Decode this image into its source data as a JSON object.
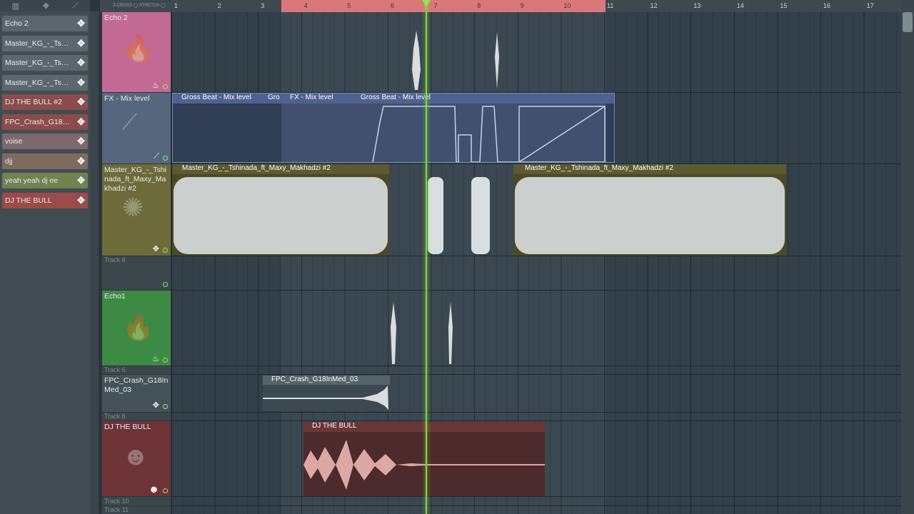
{
  "browser": {
    "clips": [
      {
        "label": "Echo 2",
        "color": "#5c676d"
      },
      {
        "label": "Master_KG_-_Tshina...",
        "color": "#5c676d"
      },
      {
        "label": "Master_KG_-_Tshina...",
        "color": "#5c676d"
      },
      {
        "label": "Master_KG_-_Tshina...",
        "color": "#5c676d"
      },
      {
        "label": "DJ THE BULL #2",
        "color": "#8a4d4c"
      },
      {
        "label": "FPC_Crash_G18InMe...",
        "color": "#8a4d4c"
      },
      {
        "label": "voise",
        "color": "#7d686d"
      },
      {
        "label": "djj",
        "color": "#7f6a62"
      },
      {
        "label": "yeah yeah dj ee",
        "color": "#6f8250"
      },
      {
        "label": "DJ THE BULL",
        "color": "#9c4a4a"
      }
    ],
    "move_icon": "✥"
  },
  "ruler": {
    "zcross": "Z-CROSS",
    "stretch": "STRETCH",
    "bars": [
      "1",
      "2",
      "3",
      "4",
      "5",
      "6",
      "7",
      "8",
      "9",
      "10",
      "11",
      "12",
      "13",
      "14",
      "15",
      "16",
      "17"
    ]
  },
  "tracks": {
    "t1": {
      "name": "Echo 2"
    },
    "t2": {
      "name": "FX - Mix level"
    },
    "t3": {
      "name": "Master_KG_-_Tshinada_ft_Maxy_Makhadzi #2"
    },
    "t4": {
      "name": "Track 4"
    },
    "t5": {
      "name": "Echo1"
    },
    "t6": {
      "name": "Track 6"
    },
    "t7": {
      "name": "FPC_Crash_G18InMed_03"
    },
    "t8": {
      "name": "Track 8"
    },
    "t9": {
      "name": "DJ THE BULL"
    },
    "t10": {
      "name": "Track 10"
    },
    "t11": {
      "name": "Track 11"
    }
  },
  "clips": {
    "gross1": "Gross Beat - Mix level",
    "gross2": "Gro",
    "fx": "FX - Mix level",
    "gross3": "Gross Beat - Mix level",
    "master1": "Master_KG_-_Tshinada_ft_Maxy_Makhadzi #2",
    "master2": "Master_KG_-_Tshinada_ft_Maxy_Makhadzi #2",
    "crash": "FPC_Crash_G18InMed_03",
    "bull": "DJ THE BULL"
  }
}
